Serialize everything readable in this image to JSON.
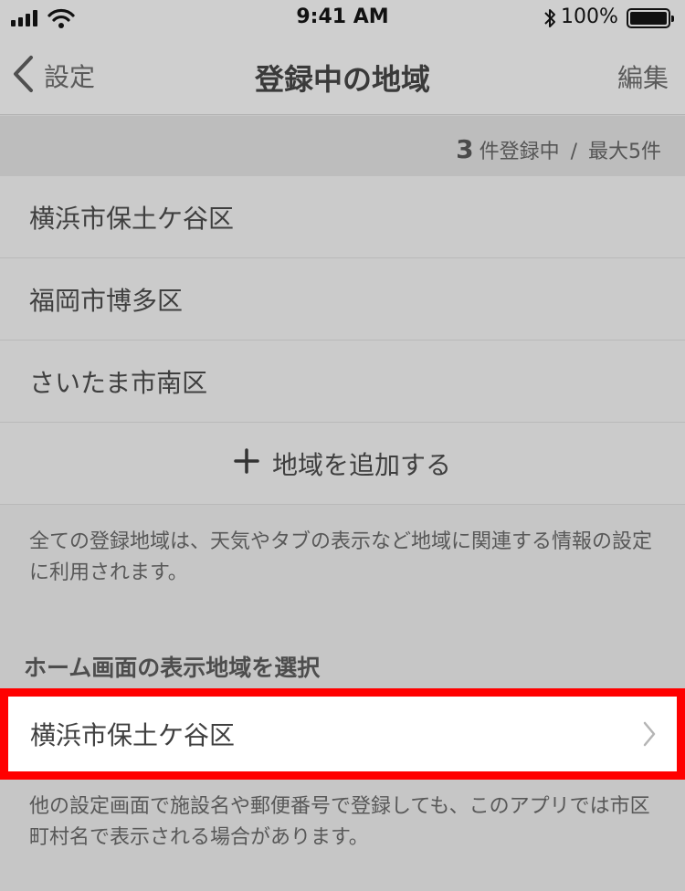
{
  "status_bar": {
    "time": "9:41 AM",
    "battery_percent": "100%"
  },
  "nav": {
    "back_label": "設定",
    "title": "登録中の地域",
    "edit_label": "編集"
  },
  "registration": {
    "count": "3",
    "count_suffix": "件登録中",
    "separator": "/",
    "max_label": "最大5件"
  },
  "regions": [
    {
      "name": "横浜市保土ケ谷区"
    },
    {
      "name": "福岡市博多区"
    },
    {
      "name": "さいたま市南区"
    }
  ],
  "add_region_label": "地域を追加する",
  "note_registered": "全ての登録地域は、天気やタブの表示など地域に関連する情報の設定に利用されます。",
  "home_section": {
    "header": "ホーム画面の表示地域を選択",
    "selected_region": "横浜市保土ケ谷区"
  },
  "note_display": "他の設定画面で施設名や郵便番号で登録しても、このアプリでは市区町村名で表示される場合があります。"
}
